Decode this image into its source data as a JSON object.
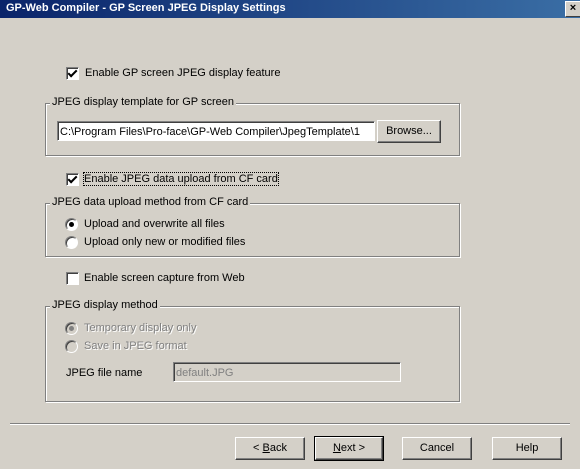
{
  "window": {
    "title": "GP-Web Compiler - GP Screen JPEG Display Settings",
    "close_glyph": "×"
  },
  "enable_feature": {
    "label": "Enable GP screen JPEG display feature",
    "checked": true
  },
  "template_group": {
    "title": "JPEG display template for GP screen",
    "path_value": "C:\\Program Files\\Pro-face\\GP-Web Compiler\\JpegTemplate\\1",
    "browse_label": "Browse..."
  },
  "enable_upload": {
    "label": "Enable JPEG data upload from CF card",
    "checked": true
  },
  "upload_group": {
    "title": "JPEG data upload method from CF card",
    "options": [
      {
        "label": "Upload and overwrite all files",
        "selected": true
      },
      {
        "label": "Upload only new or modified files",
        "selected": false
      }
    ]
  },
  "enable_capture": {
    "label": "Enable screen capture from Web",
    "checked": false
  },
  "display_group": {
    "title": "JPEG display method",
    "options": [
      {
        "label": "Temporary display only",
        "selected": true
      },
      {
        "label": "Save in JPEG format",
        "selected": false
      }
    ],
    "filename_label": "JPEG file name",
    "filename_value": "default.JPG"
  },
  "buttons": {
    "back_prefix": "< ",
    "back_mnemonic": "B",
    "back_rest": "ack",
    "next_mnemonic": "N",
    "next_rest": "ext >",
    "cancel": "Cancel",
    "help": "Help"
  }
}
